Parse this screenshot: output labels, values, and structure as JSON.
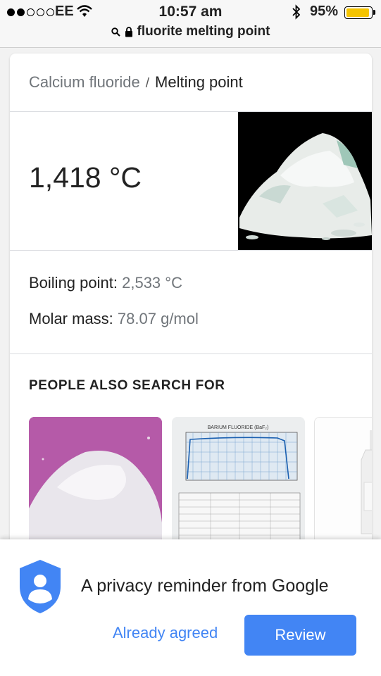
{
  "status_bar": {
    "carrier": "EE",
    "time": "10:57 am",
    "battery_percent": "95%",
    "battery_level": 0.95,
    "signal_bars_filled": 2,
    "signal_bars_total": 5
  },
  "address_bar": {
    "query": "fluorite melting point",
    "icons": [
      "search-icon",
      "lock-icon"
    ]
  },
  "knowledge_card": {
    "breadcrumb": {
      "parent": "Calcium fluoride",
      "separator": "/",
      "current": "Melting point"
    },
    "answer": "1,418 °C",
    "facts": [
      {
        "label": "Boiling point:",
        "value": "2,533 °C"
      },
      {
        "label": "Molar mass:",
        "value": "78.07 g/mol"
      }
    ],
    "people_also_search_for": {
      "heading": "PEOPLE ALSO SEARCH FOR",
      "chart_title": "BARIUM FLUORIDE (BaF₂)"
    }
  },
  "privacy_sheet": {
    "message": "A privacy reminder from Google",
    "already_agreed": "Already agreed",
    "review": "Review"
  },
  "colors": {
    "accent": "#4285f4",
    "secondary_text": "#70757a",
    "battery": "#f5c400"
  }
}
